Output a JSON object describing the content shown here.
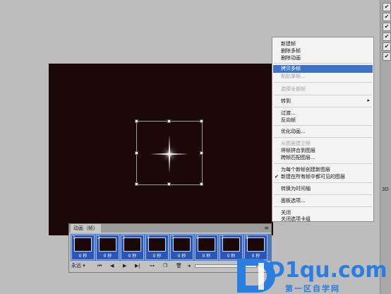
{
  "context_menu": {
    "items": [
      {
        "label": "新建帧",
        "disabled": false
      },
      {
        "label": "删除多帧",
        "disabled": false
      },
      {
        "label": "删除动画",
        "disabled": false
      },
      {
        "label": "拷贝多帧",
        "disabled": false,
        "highlighted": true
      },
      {
        "label": "粘贴单帧...",
        "disabled": true
      },
      {
        "label": "选择全部帧",
        "disabled": true
      },
      {
        "label": "转到",
        "disabled": false,
        "submenu": true
      },
      {
        "label": "过渡...",
        "disabled": false
      },
      {
        "label": "反向帧",
        "disabled": false
      },
      {
        "label": "优化动画...",
        "disabled": false
      },
      {
        "label": "从图层建立帧",
        "disabled": true
      },
      {
        "label": "将帧拼合到图层",
        "disabled": false
      },
      {
        "label": "跨帧匹配图层...",
        "disabled": false
      },
      {
        "label": "为每个新帧创建新图层",
        "disabled": false
      },
      {
        "label": "新建在所有帧中都可见的图层",
        "disabled": false,
        "checked": true
      },
      {
        "label": "转换为时间轴",
        "disabled": false
      },
      {
        "label": "面板选项...",
        "disabled": false
      },
      {
        "label": "关闭",
        "disabled": false
      },
      {
        "label": "关闭选项卡组",
        "disabled": false
      }
    ],
    "submenu_arrow": "▸",
    "check_mark": "✔"
  },
  "animation_panel": {
    "tab_label": "动画（帧）",
    "frames": [
      {
        "number": "1",
        "time": "0 秒"
      },
      {
        "number": "2",
        "time": "0 秒"
      },
      {
        "number": "3",
        "time": "0 秒"
      },
      {
        "number": "4",
        "time": "0 秒"
      },
      {
        "number": "5",
        "time": "0 秒"
      },
      {
        "number": "6",
        "time": "0 秒"
      },
      {
        "number": "7",
        "time": "0 秒"
      },
      {
        "number": "8",
        "time": "0 秒"
      }
    ],
    "loop_label": "永远",
    "selected_color": "#2a56b8"
  },
  "right_panel": {
    "checks": [
      "✔",
      "✔",
      "✔",
      "✔",
      "✔",
      "✔"
    ],
    "label_3d": "3D"
  },
  "watermark": {
    "latin": "D1qu.com",
    "chinese": "第一区自学网"
  },
  "colors": {
    "canvas": "#1b0809",
    "menu_highlight": "#3d72c7",
    "watermark": "#2b7de0"
  }
}
